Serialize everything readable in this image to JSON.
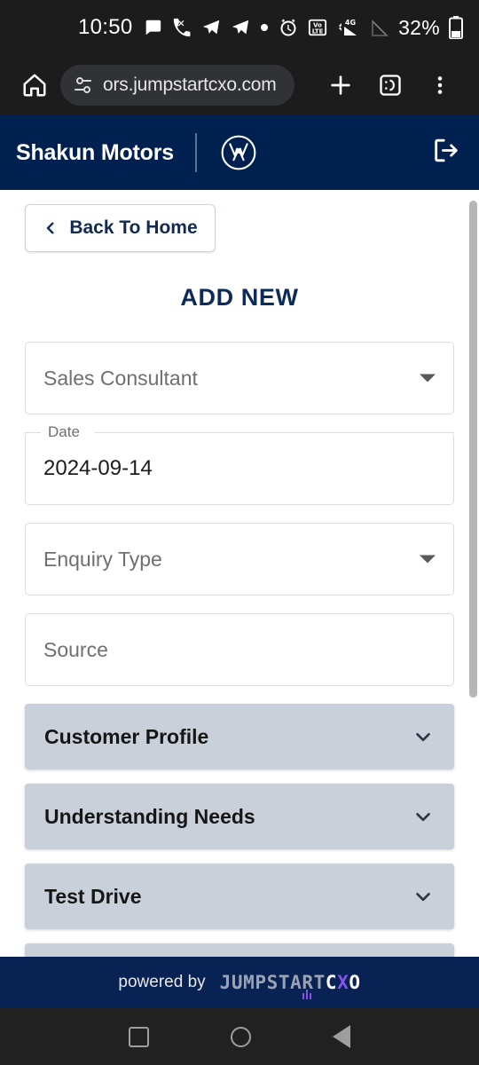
{
  "status_bar": {
    "time": "10:50",
    "battery_percent": "32%",
    "icons": [
      "chat-bubble-icon",
      "missed-call-icon",
      "telegram-icon",
      "telegram-icon",
      "dot-icon"
    ],
    "right_icons": [
      "alarm-icon",
      "volte-icon",
      "signal-4g-icon",
      "signal-empty-icon",
      "battery-icon"
    ],
    "volte_label": "VoLTE",
    "network_label": "4G"
  },
  "browser": {
    "url": "ors.jumpstartcxo.com",
    "home_icon": "home-icon",
    "site_settings_icon": "tune-icon",
    "new_tab_icon": "plus-icon",
    "reader_icon": "reader-mode-icon",
    "menu_icon": "overflow-menu-icon"
  },
  "app_header": {
    "brand": "Shakun Motors",
    "logo_icon": "volkswagen-logo-icon",
    "logout_icon": "logout-icon"
  },
  "main": {
    "back_button": "Back To Home",
    "back_icon": "chevron-left-icon",
    "title": "ADD NEW",
    "fields": [
      {
        "name": "sales-consultant",
        "placeholder": "Sales Consultant",
        "value": "",
        "type": "select",
        "label": "",
        "has_caret": true
      },
      {
        "name": "date",
        "placeholder": "",
        "value": "2024-09-14",
        "type": "date",
        "label": "Date",
        "has_caret": false
      },
      {
        "name": "enquiry-type",
        "placeholder": "Enquiry Type",
        "value": "",
        "type": "select",
        "label": "",
        "has_caret": true
      },
      {
        "name": "source",
        "placeholder": "Source",
        "value": "",
        "type": "text",
        "label": "",
        "has_caret": false
      }
    ],
    "accordions": [
      {
        "name": "customer-profile",
        "label": "Customer Profile",
        "icon": "chevron-down-icon"
      },
      {
        "name": "understanding-needs",
        "label": "Understanding Needs",
        "icon": "chevron-down-icon"
      },
      {
        "name": "test-drive",
        "label": "Test Drive",
        "icon": "chevron-down-icon"
      }
    ]
  },
  "footer": {
    "powered_by": "powered by",
    "logo_part1": "JUMPSTART",
    "logo_part2_c": "C",
    "logo_part2_x": "X",
    "logo_part2_o": "O"
  },
  "nav_bar": {
    "recents_icon": "square-recents-icon",
    "home_icon": "circle-home-icon",
    "back_icon": "triangle-back-icon"
  },
  "colors": {
    "navy": "#002050",
    "footer_navy": "#072253",
    "accordion_bg": "#c9d0da",
    "title_blue": "#0d2b57",
    "accent_purple": "#8b4ff0"
  }
}
